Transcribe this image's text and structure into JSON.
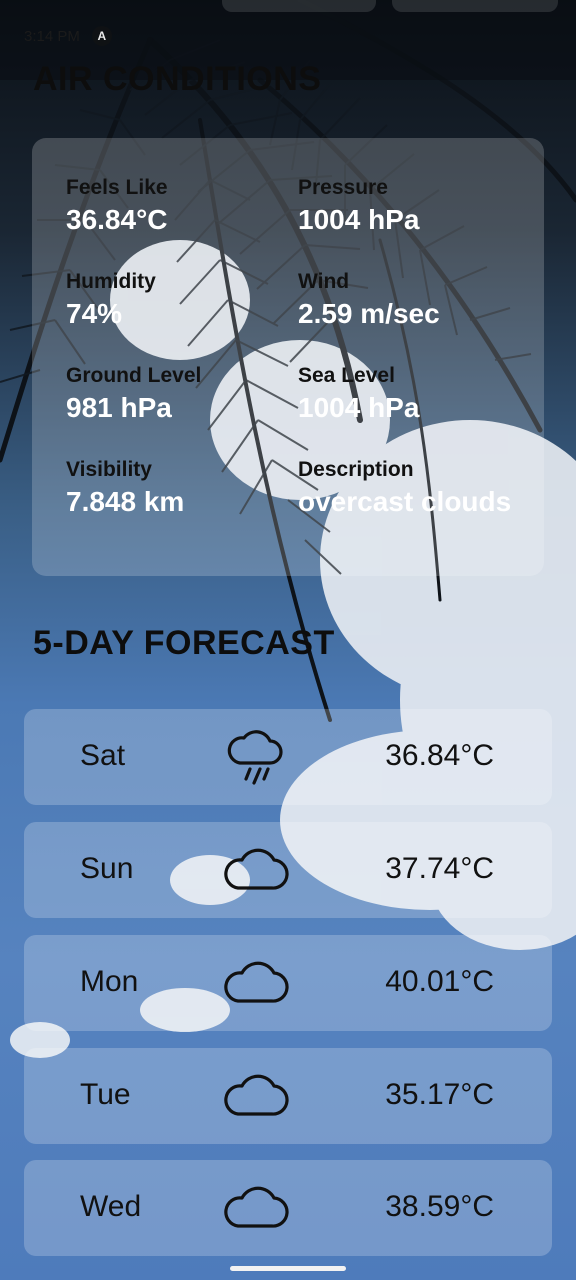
{
  "status_bar": {
    "time": "3:14 PM",
    "badge": "A"
  },
  "conditions": {
    "title": "AIR CONDITIONS",
    "items": [
      {
        "label": "Feels Like",
        "value": "36.84°C"
      },
      {
        "label": "Pressure",
        "value": "1004 hPa"
      },
      {
        "label": "Humidity",
        "value": "74%"
      },
      {
        "label": "Wind",
        "value": "2.59 m/sec"
      },
      {
        "label": "Ground Level",
        "value": "981 hPa"
      },
      {
        "label": "Sea Level",
        "value": "1004 hPa"
      },
      {
        "label": "Visibility",
        "value": "7.848 km"
      },
      {
        "label": "Description",
        "value": "overcast clouds"
      }
    ]
  },
  "forecast": {
    "title": "5-DAY FORECAST",
    "days": [
      {
        "day": "Sat",
        "icon": "cloud-rain-icon",
        "temp": "36.84°C"
      },
      {
        "day": "Sun",
        "icon": "cloud-icon",
        "temp": "37.74°C"
      },
      {
        "day": "Mon",
        "icon": "cloud-icon",
        "temp": "40.01°C"
      },
      {
        "day": "Tue",
        "icon": "cloud-icon",
        "temp": "35.17°C"
      },
      {
        "day": "Wed",
        "icon": "cloud-icon",
        "temp": "38.59°C"
      }
    ]
  }
}
